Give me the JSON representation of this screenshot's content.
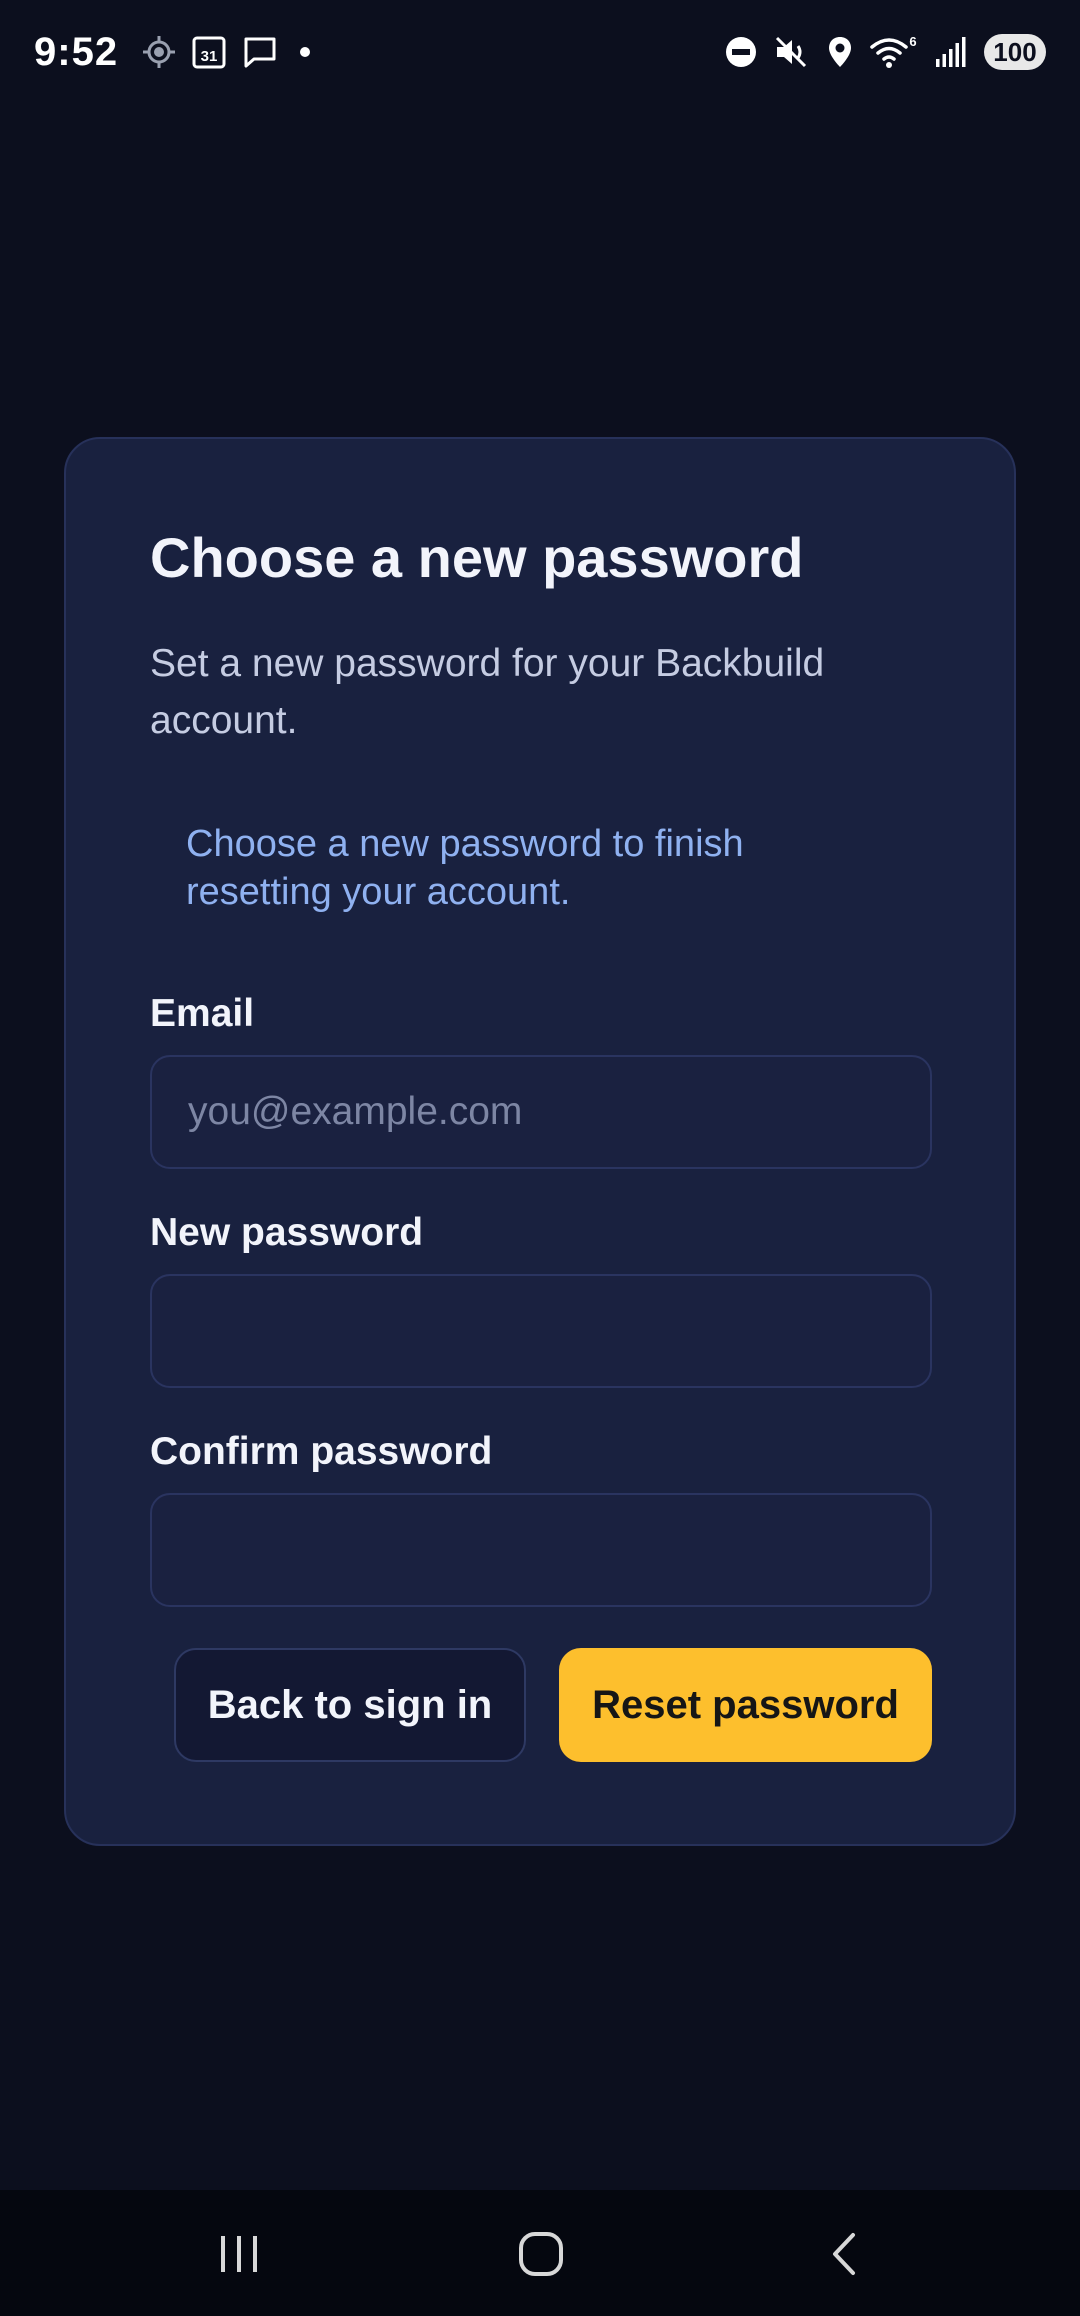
{
  "status_bar": {
    "time": "9:52",
    "left_icons": [
      "location-target-icon",
      "calendar-icon",
      "message-icon",
      "notification-dot-icon"
    ],
    "calendar_day": "31",
    "right_icons": [
      "do-not-disturb-icon",
      "mute-icon",
      "location-pin-icon",
      "wifi-icon",
      "signal-icon"
    ],
    "wifi_badge": "6",
    "battery": "100"
  },
  "card": {
    "title": "Choose a new password",
    "subtitle": "Set a new password for your Backbuild account.",
    "info_note": "Choose a new password to finish resetting your account.",
    "fields": {
      "email": {
        "label": "Email",
        "placeholder": "you@example.com",
        "value": ""
      },
      "new_password": {
        "label": "New password",
        "value": ""
      },
      "confirm_password": {
        "label": "Confirm password",
        "value": ""
      }
    },
    "buttons": {
      "back_label": "Back to sign in",
      "reset_label": "Reset password"
    }
  },
  "nav_bar": {
    "buttons": [
      "recents-icon",
      "home-icon",
      "back-icon"
    ]
  },
  "colors": {
    "background": "#0c0f1e",
    "card": "#19213f",
    "accent": "#fdbf2d",
    "info_text": "#8fb1f0"
  }
}
